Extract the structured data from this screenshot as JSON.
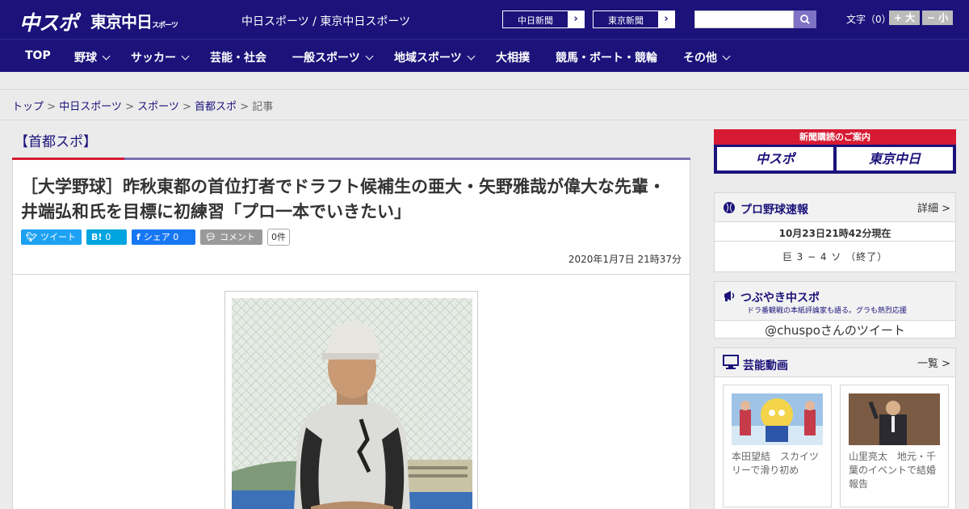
{
  "header": {
    "logo_chuspo": "中スポ",
    "logo_tokyo": "東京中日",
    "logo_tokyo_sub": "スポーツ",
    "site_link_1": "中日スポーツ",
    "site_link_sep": " / ",
    "site_link_2": "東京中日スポーツ",
    "paper_btn_1": "中日新聞",
    "paper_btn_2": "東京新聞",
    "search_placeholder": "",
    "font_size_label": "文字（0）",
    "font_bigger": "+ 大",
    "font_smaller": "− 小"
  },
  "nav": [
    {
      "label": "TOP",
      "dropdown": false
    },
    {
      "label": "野球",
      "dropdown": true
    },
    {
      "label": "サッカー",
      "dropdown": true
    },
    {
      "label": "芸能・社会",
      "dropdown": false
    },
    {
      "label": "一般スポーツ",
      "dropdown": true
    },
    {
      "label": "地域スポーツ",
      "dropdown": true
    },
    {
      "label": "大相撲",
      "dropdown": false
    },
    {
      "label": "競馬・ボート・競輪",
      "dropdown": false
    },
    {
      "label": "その他",
      "dropdown": true
    }
  ],
  "breadcrumb": {
    "items": [
      "トップ",
      "中日スポーツ",
      "スポーツ",
      "首都スポ"
    ],
    "current": "記事",
    "sep": " > "
  },
  "article": {
    "category": "【首都スポ】",
    "headline": "［大学野球］昨秋東都の首位打者でドラフト候補生の亜大・矢野雅哉が偉大な先輩・井端弘和氏を目標に初練習「プロ一本でいきたい」",
    "share": {
      "tweet": "ツイート",
      "hatena_count": "0",
      "facebook": "シェア 0",
      "comment": "コメント",
      "comment_count": "0件"
    },
    "date": "2020年1月7日 21時37分"
  },
  "sidebar": {
    "subscribe_title": "新聞購読のご案内",
    "subscribe_btn_1": "中スポ",
    "subscribe_btn_2": "東京中日",
    "baseball": {
      "title": "プロ野球速報",
      "more": "詳細 >",
      "time": "10月23日21時42分現在",
      "score": "巨 3 − 4 ソ （終了）"
    },
    "tweets": {
      "title": "つぶやき中スポ",
      "subtitle": "ドラ番観戦の本紙評論家も語る。グラも熱烈応援",
      "link": "@chuspoさんのツイート"
    },
    "videos": {
      "title": "芸能動画",
      "more": "一覧 >",
      "items": [
        {
          "caption": "本田望結　スカイツリーで滑り初め"
        },
        {
          "caption": "山里亮太　地元・千葉のイベントで結婚報告"
        }
      ]
    }
  },
  "colors": {
    "brand_navy": "#1b127a",
    "accent_red": "#d71a33",
    "twitter": "#1da1f2",
    "hatena": "#00a4de",
    "facebook": "#1877f2",
    "comment": "#999999"
  }
}
